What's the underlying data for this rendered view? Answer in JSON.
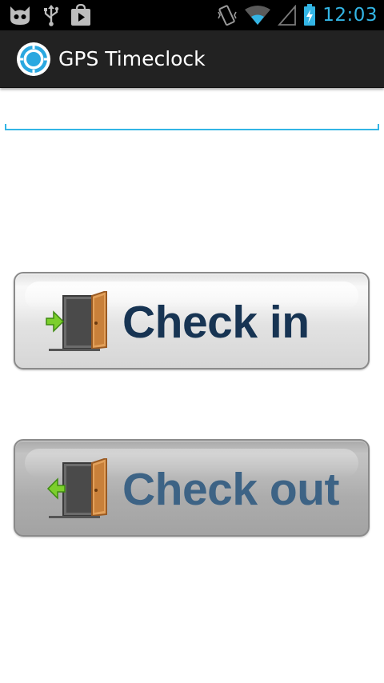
{
  "status_bar": {
    "time": "12:03",
    "left_icons": [
      "cyanogen-mod-icon",
      "usb-icon",
      "play-store-icon"
    ],
    "right_icons": [
      "vibrate-icon",
      "wifi-icon",
      "signal-icon",
      "battery-charging-icon"
    ],
    "accent_color": "#33b5e5"
  },
  "action_bar": {
    "title": "GPS Timeclock",
    "icon": "target-icon"
  },
  "form": {
    "text_value": "",
    "placeholder": ""
  },
  "buttons": {
    "check_in_label": "Check in",
    "check_out_label": "Check out"
  }
}
